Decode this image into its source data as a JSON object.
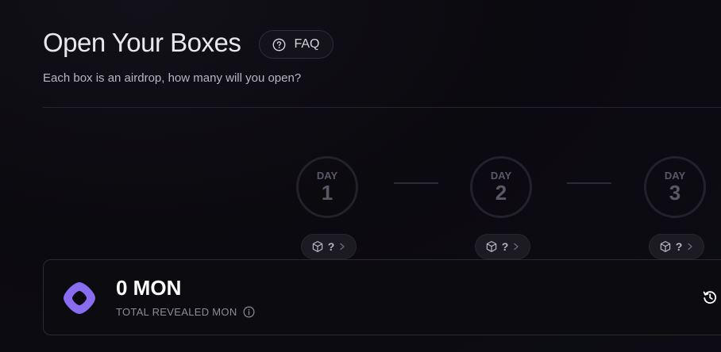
{
  "header": {
    "title": "Open Your Boxes",
    "faq_label": "FAQ",
    "subtitle": "Each box is an airdrop, how many will you open?"
  },
  "days": [
    {
      "label": "DAY",
      "number": "1",
      "reward": "?"
    },
    {
      "label": "DAY",
      "number": "2",
      "reward": "?"
    },
    {
      "label": "DAY",
      "number": "3",
      "reward": "?"
    }
  ],
  "summary": {
    "amount": "0 MON",
    "label": "TOTAL REVEALED MON"
  },
  "icons": {
    "faq": "question-circle-icon",
    "box": "cube-icon",
    "chevron": "chevron-right-icon",
    "logo": "monad-logo-icon",
    "info": "info-icon",
    "history": "history-icon"
  },
  "colors": {
    "background": "#0b0a0f",
    "accent": "#8a6cf0",
    "day_circle": "#23222a"
  }
}
